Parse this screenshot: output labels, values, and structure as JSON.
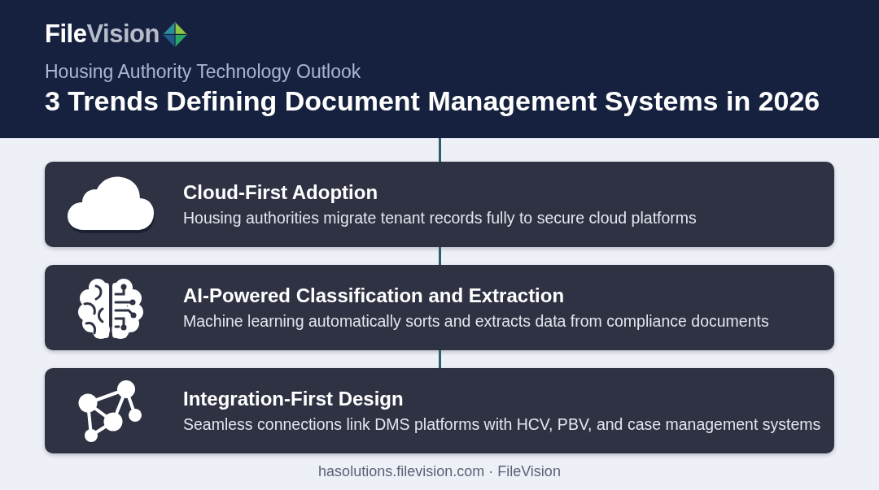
{
  "header": {
    "logo": {
      "wordmark": [
        "File",
        "Vision"
      ]
    },
    "subtitle": "Housing Authority Technology Outlook",
    "title": "3 Trends Defining Document Management Systems in 2026"
  },
  "trends": [
    {
      "title": "Cloud-First Adoption",
      "description": "Housing authorities migrate tenant records fully to secure cloud platforms"
    },
    {
      "title": "AI-Powered Classification and Extraction",
      "description": "Machine learning automatically sorts and extracts data from compliance documents"
    },
    {
      "title": "Integration-First Design",
      "description": "Seamless connections link DMS platforms with HCV, PBV, and case management systems"
    }
  ],
  "footer": {
    "text": "hasolutions.filevision.com · FileVision"
  }
}
